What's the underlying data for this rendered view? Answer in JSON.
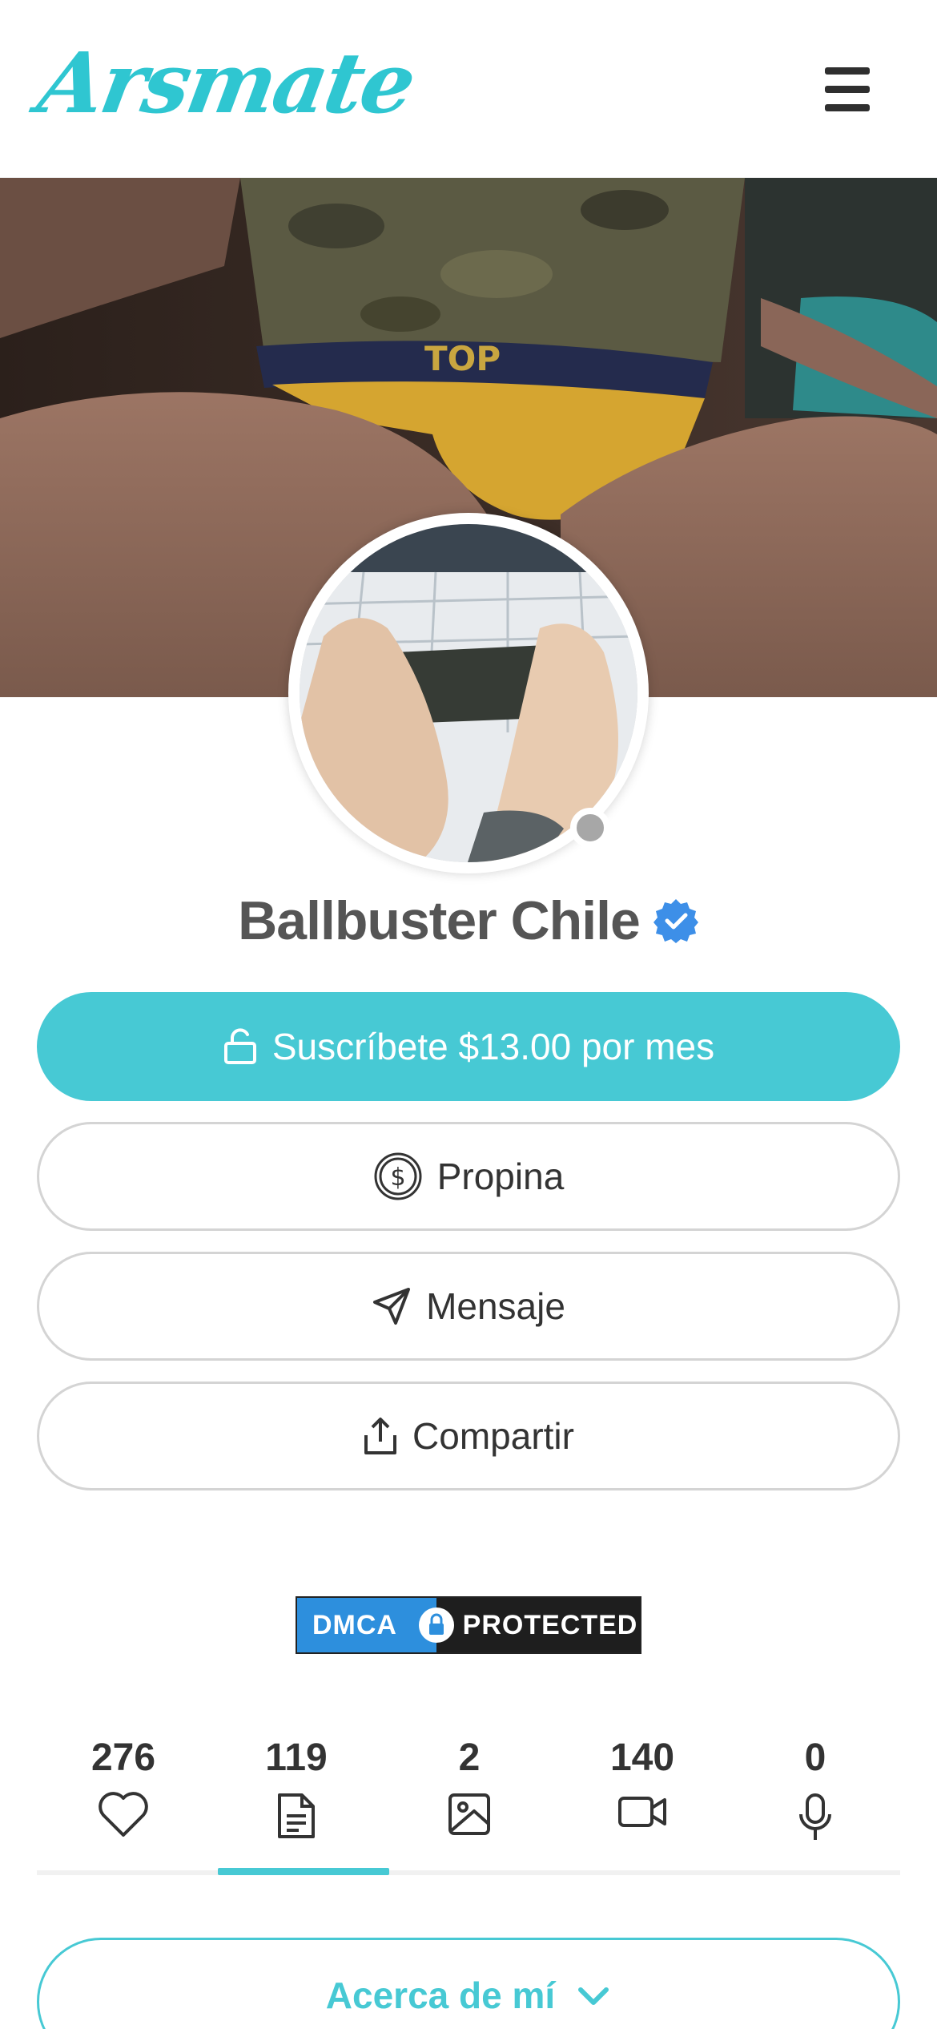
{
  "header": {
    "logo_text": "Arsmate",
    "menu_icon": "hamburger-menu-icon"
  },
  "profile": {
    "name": "Ballbuster Chile",
    "verified": true,
    "online_status": "offline"
  },
  "actions": {
    "subscribe_label": "Suscríbete $13.00 por mes",
    "tip_label": "Propina",
    "message_label": "Mensaje",
    "share_label": "Compartir"
  },
  "badge": {
    "left": "DMCA",
    "right": "PROTECTED"
  },
  "stats": [
    {
      "count": "276",
      "icon": "heart-icon"
    },
    {
      "count": "119",
      "icon": "document-icon"
    },
    {
      "count": "2",
      "icon": "image-icon"
    },
    {
      "count": "140",
      "icon": "video-icon"
    },
    {
      "count": "0",
      "icon": "microphone-icon"
    }
  ],
  "about": {
    "label": "Acerca de mí"
  },
  "colors": {
    "accent": "#47c9d4",
    "logo": "#2fc6d1",
    "verified": "#3d8fe8",
    "dmca_blue": "#2d8fdd"
  }
}
